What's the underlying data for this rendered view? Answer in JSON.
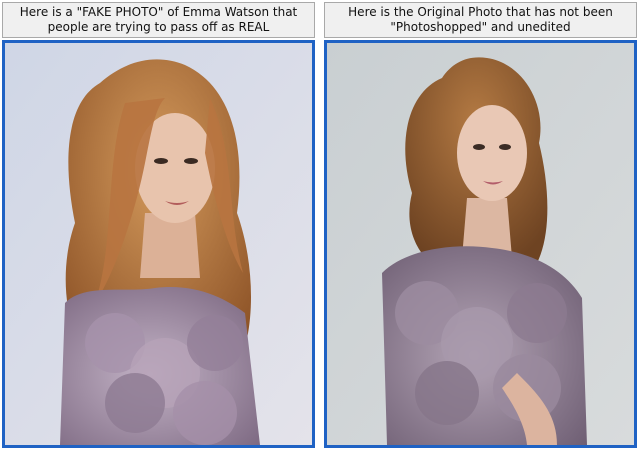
{
  "panels": {
    "left": {
      "caption_line1": "Here is a \"FAKE PHOTO\" of Emma Watson that",
      "caption_line2": "people are trying to pass off as REAL",
      "photo_description_icon": "portrait-photo-icon"
    },
    "right": {
      "caption_line1": "Here is the Original Photo that has not been",
      "caption_line2": "\"Photoshopped\" and unedited",
      "photo_description_icon": "portrait-photo-icon"
    }
  },
  "colors": {
    "frame_border": "#1f62c4",
    "caption_bg": "#f0f0f0",
    "caption_border": "#a9a9a9",
    "left_bg": "#d9dde8",
    "right_bg": "#cfd4d6",
    "hair_left": "#b8773f",
    "hair_right": "#9a6436",
    "dress": "#9c8aa0",
    "skin": "#e6c1aa"
  }
}
